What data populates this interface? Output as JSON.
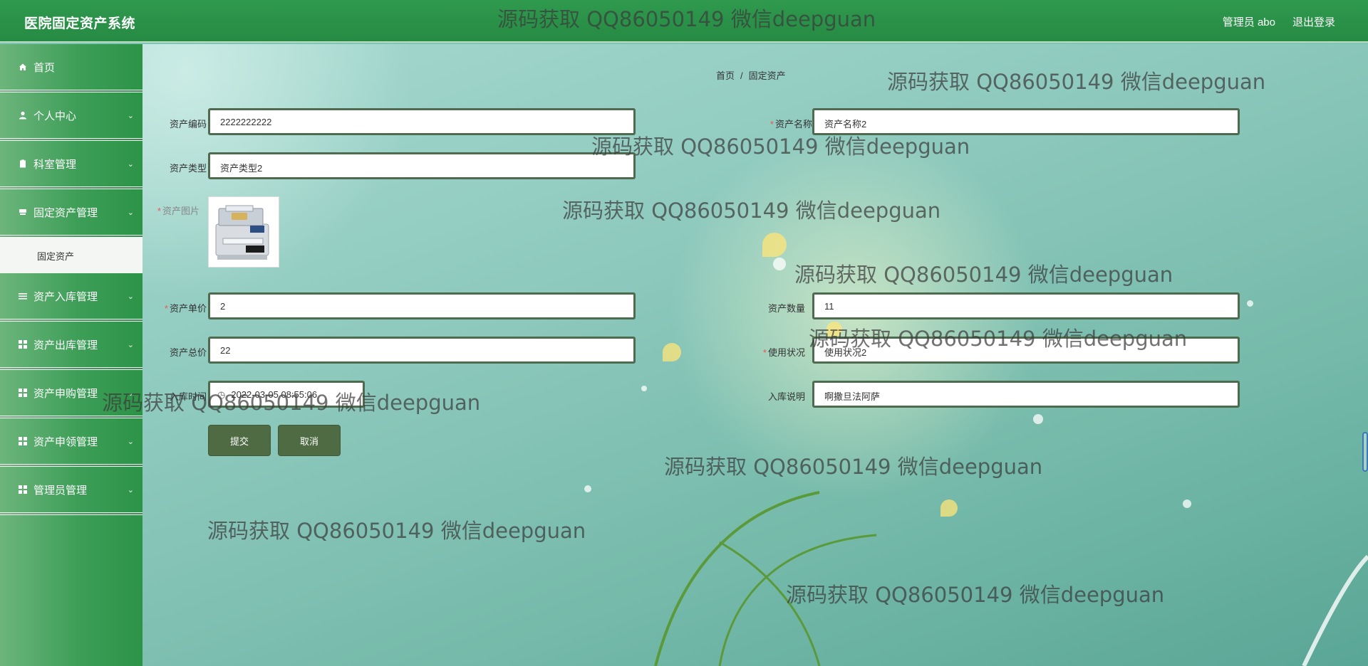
{
  "header": {
    "title": "医院固定资产系统",
    "user_label": "管理员 abo",
    "logout_label": "退出登录"
  },
  "sidebar": {
    "items": [
      {
        "label": "首页",
        "icon": "home-icon"
      },
      {
        "label": "个人中心",
        "icon": "user-icon"
      },
      {
        "label": "科室管理",
        "icon": "clipboard-icon"
      },
      {
        "label": "固定资产管理",
        "icon": "box-icon"
      },
      {
        "label": "资产入库管理",
        "icon": "list-icon"
      },
      {
        "label": "资产出库管理",
        "icon": "grid-icon"
      },
      {
        "label": "资产申购管理",
        "icon": "grid-icon"
      },
      {
        "label": "资产申领管理",
        "icon": "grid-icon"
      },
      {
        "label": "管理员管理",
        "icon": "grid-icon"
      }
    ],
    "submenu": {
      "label": "固定资产"
    }
  },
  "breadcrumb": {
    "home": "首页",
    "separator": "/",
    "current": "固定资产"
  },
  "form": {
    "asset_code": {
      "label": "资产编码",
      "value": "2222222222"
    },
    "asset_name": {
      "label": "资产名称",
      "value": "资产名称2"
    },
    "asset_type": {
      "label": "资产类型",
      "value": "资产类型2"
    },
    "asset_image": {
      "label": "资产图片"
    },
    "unit_price": {
      "label": "资产单价",
      "value": "2"
    },
    "quantity": {
      "label": "资产数量",
      "value": "11"
    },
    "total_price": {
      "label": "资产总价",
      "value": "22"
    },
    "usage_status": {
      "label": "使用状况",
      "value": "使用状况2"
    },
    "stock_in_time": {
      "label": "入库时间",
      "value": "2022-03-05 08:55:06"
    },
    "stock_in_note": {
      "label": "入库说明",
      "value": "啊撒旦法阿萨"
    }
  },
  "buttons": {
    "submit": "提交",
    "cancel": "取消"
  },
  "watermark": "源码获取 QQ86050149 微信deepguan",
  "colors": {
    "header": "#2a914a",
    "sidebar": "#3d9e57",
    "button": "#4f6b44",
    "input_border": "#4f6b4f"
  }
}
